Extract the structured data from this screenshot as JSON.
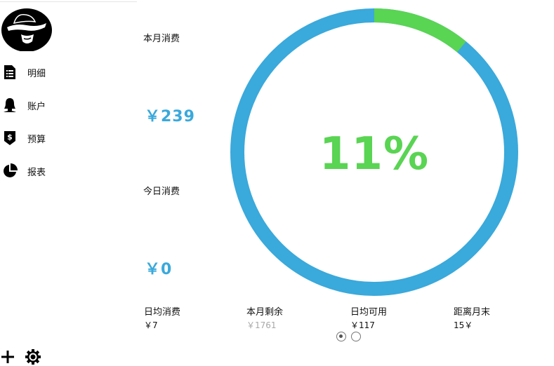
{
  "sidebar": {
    "items": [
      {
        "label": "明细",
        "icon": "document-icon"
      },
      {
        "label": "账户",
        "icon": "user-icon"
      },
      {
        "label": "预算",
        "icon": "budget-tag-icon"
      },
      {
        "label": "报表",
        "icon": "pie-chart-icon"
      }
    ],
    "add_icon": "plus-icon",
    "settings_icon": "gear-icon"
  },
  "summary": {
    "month_spend_label": "本月消费",
    "month_spend_value": "￥239",
    "today_spend_label": "今日消费",
    "today_spend_value": "￥0"
  },
  "progress": {
    "percent_text": "11%",
    "fraction": 0.11,
    "colors": {
      "used": "#5ad453",
      "remaining": "#3aa9db"
    }
  },
  "stats": [
    {
      "label": "日均消费",
      "value": "￥7"
    },
    {
      "label": "本月剩余",
      "value": "￥1761"
    },
    {
      "label": "日均可用",
      "value": "￥117"
    },
    {
      "label": "距离月末",
      "value": "15￥"
    }
  ],
  "pager": {
    "count": 2,
    "active": 0
  }
}
